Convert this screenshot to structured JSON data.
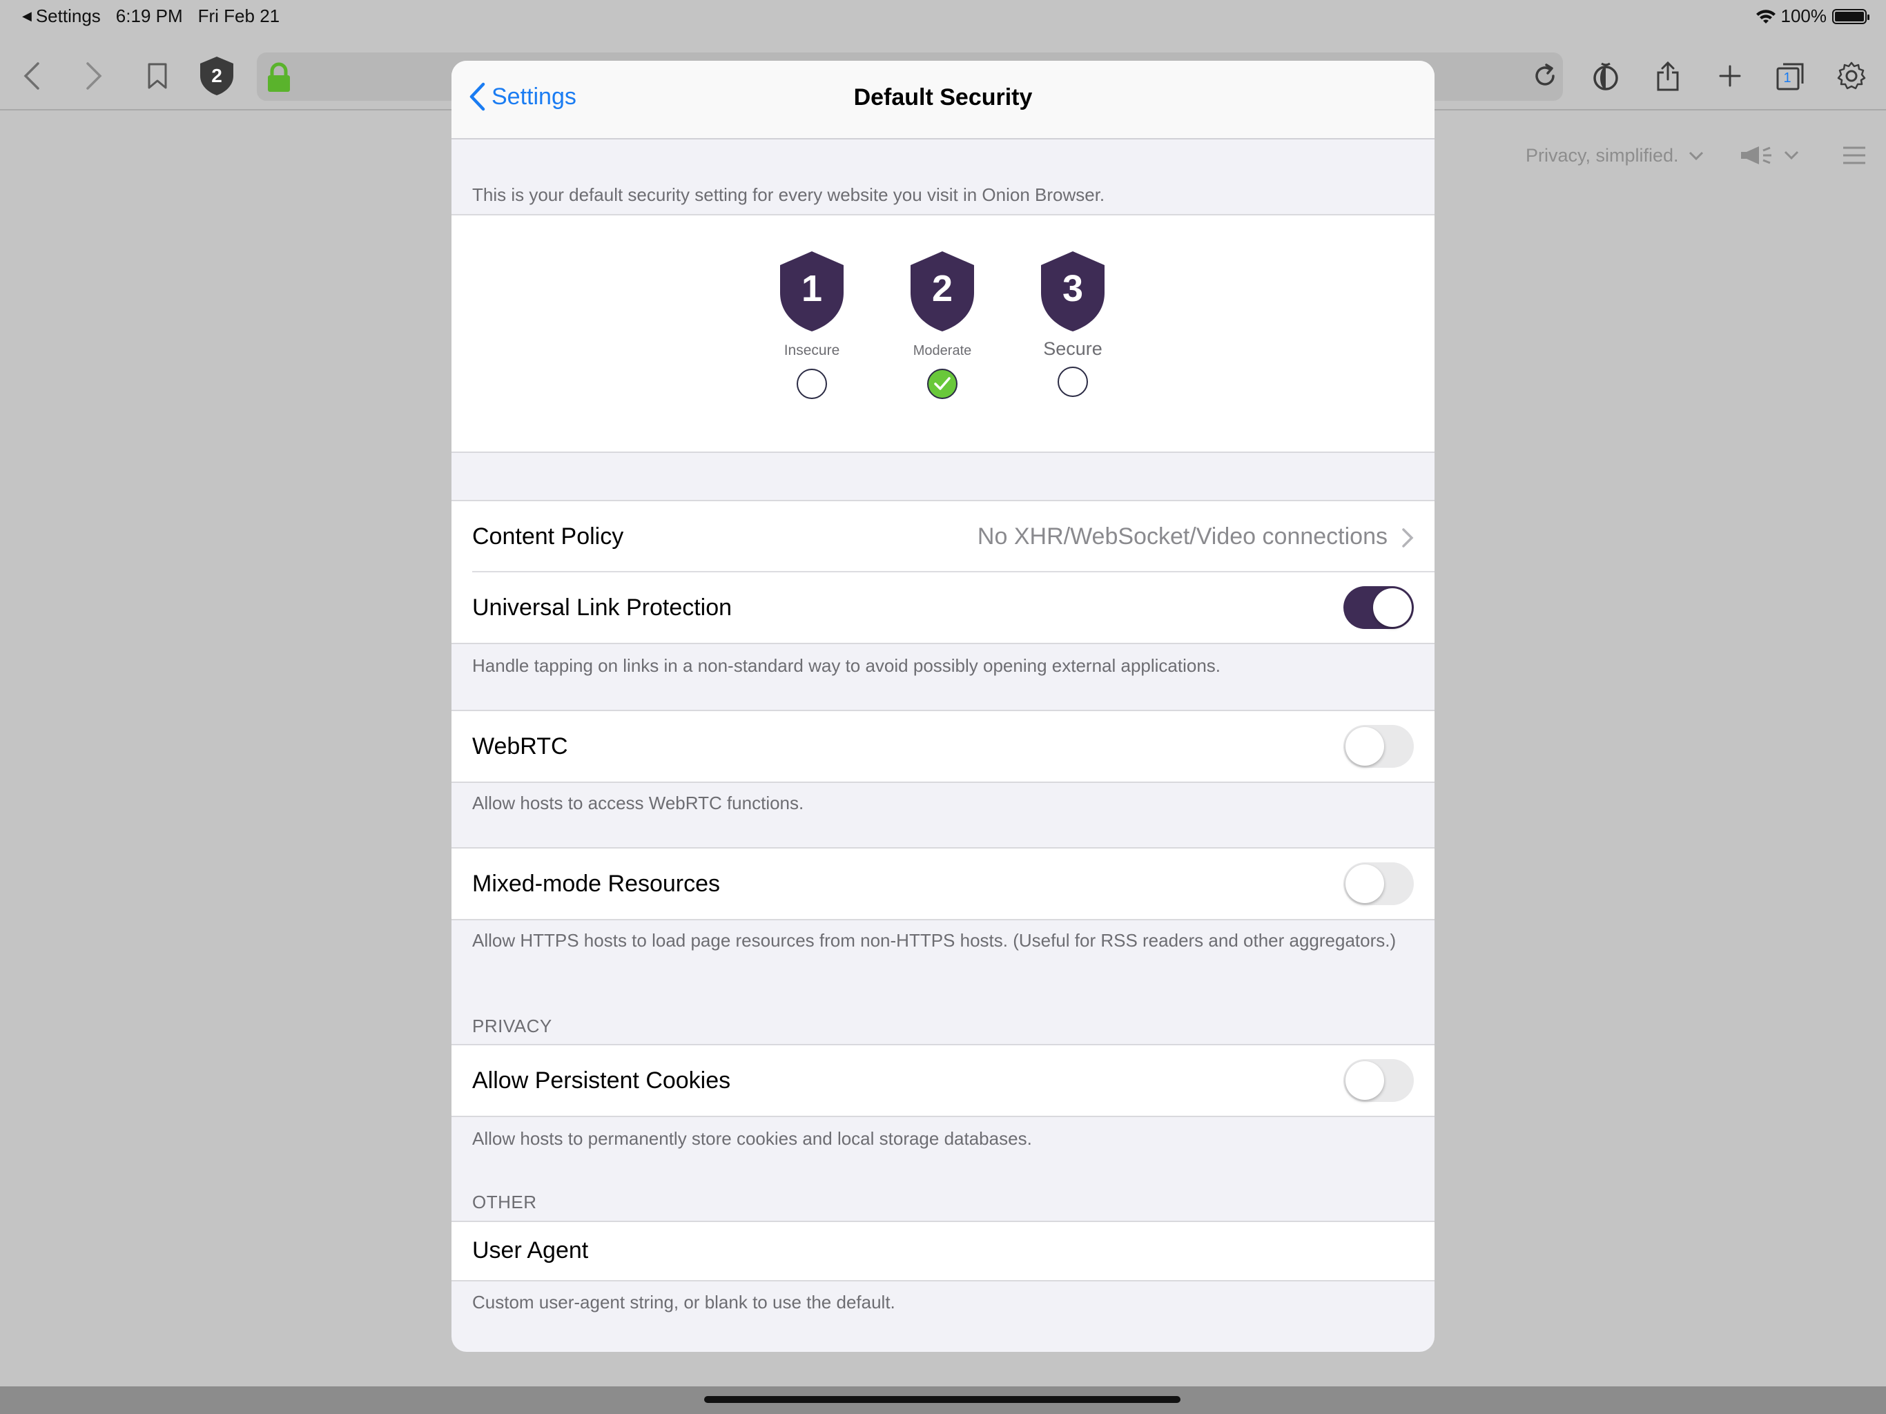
{
  "status_bar": {
    "back_app": "Settings",
    "time": "6:19 PM",
    "date": "Fri Feb 21",
    "battery": "100%"
  },
  "browser": {
    "security_badge": "2",
    "tabs_count": "1",
    "tagline": "Privacy, simplified."
  },
  "modal": {
    "back_label": "Settings",
    "title": "Default Security",
    "intro": "This is your default security setting for every website you visit in Onion Browser.",
    "levels": [
      {
        "number": "1",
        "label": "Insecure",
        "selected": false
      },
      {
        "number": "2",
        "label": "Moderate",
        "selected": true
      },
      {
        "number": "3",
        "label": "Secure",
        "selected": false
      }
    ],
    "content_policy": {
      "label": "Content Policy",
      "value": "No XHR/WebSocket/Video connections"
    },
    "universal_link": {
      "label": "Universal Link Protection",
      "enabled": true,
      "footer": "Handle tapping on links in a non-standard way to avoid possibly opening external applications."
    },
    "webrtc": {
      "label": "WebRTC",
      "enabled": false,
      "footer": "Allow hosts to access WebRTC functions."
    },
    "mixed_mode": {
      "label": "Mixed-mode Resources",
      "enabled": false,
      "footer": "Allow HTTPS hosts to load page resources from non-HTTPS hosts. (Useful for RSS readers and other aggregators.)"
    },
    "privacy_header": "PRIVACY",
    "persistent_cookies": {
      "label": "Allow Persistent Cookies",
      "enabled": false,
      "footer": "Allow hosts to permanently store cookies and local storage databases."
    },
    "other_header": "OTHER",
    "user_agent": {
      "label": "User Agent",
      "footer": "Custom user-agent string, or blank to use the default."
    }
  },
  "colors": {
    "accent_blue": "#1a7cf2",
    "shield_purple": "#3e2c55",
    "check_green": "#69c83a",
    "lock_green": "#5ab32c"
  }
}
